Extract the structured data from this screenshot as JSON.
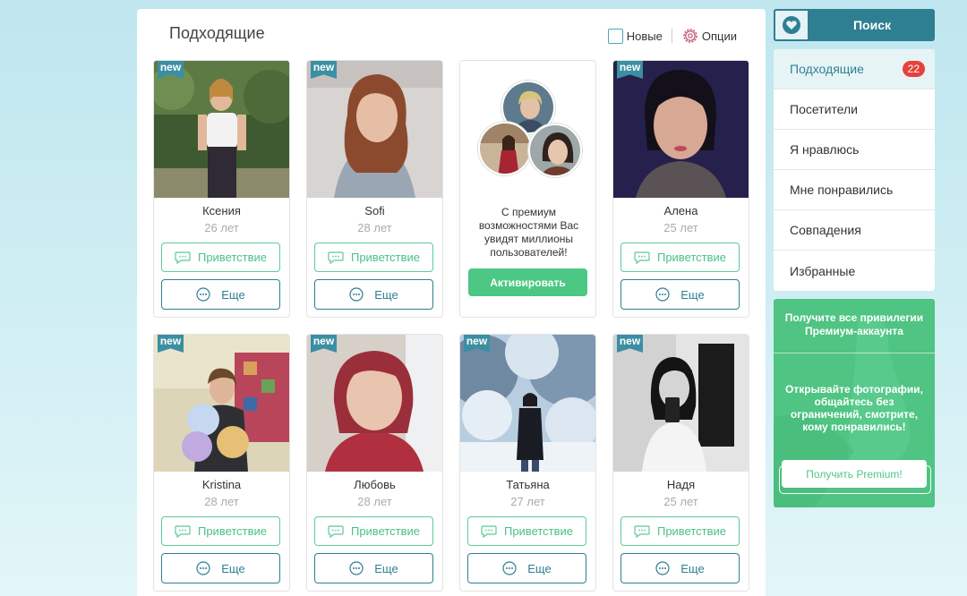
{
  "main": {
    "title": "Подходящие",
    "filter_new": "Новые",
    "options": "Опции"
  },
  "profiles": [
    {
      "name": "Ксения",
      "age": "26 лет",
      "badge": "new",
      "greet": "Приветствие",
      "more": "Еще"
    },
    {
      "name": "Sofi",
      "age": "28 лет",
      "badge": "new",
      "greet": "Приветствие",
      "more": "Еще"
    },
    {
      "name": "Алена",
      "age": "25 лет",
      "badge": "new",
      "greet": "Приветствие",
      "more": "Еще"
    },
    {
      "name": "Kristina",
      "age": "28 лет",
      "badge": "new",
      "greet": "Приветствие",
      "more": "Еще"
    },
    {
      "name": "Любовь",
      "age": "28 лет",
      "badge": "new",
      "greet": "Приветствие",
      "more": "Еще"
    },
    {
      "name": "Татьяна",
      "age": "27 лет",
      "badge": "new",
      "greet": "Приветствие",
      "more": "Еще"
    },
    {
      "name": "Надя",
      "age": "25 лет",
      "badge": "new",
      "greet": "Приветствие",
      "more": "Еще"
    }
  ],
  "promo": {
    "text": "С премиум возможностями Вас увидят миллионы пользователей!",
    "button": "Активировать"
  },
  "sidebar": {
    "search": "Поиск",
    "menu": [
      {
        "label": "Подходящие",
        "count": "22"
      },
      {
        "label": "Посетители"
      },
      {
        "label": "Я нравлюсь"
      },
      {
        "label": "Мне понравились"
      },
      {
        "label": "Совпадения"
      },
      {
        "label": "Избранные"
      }
    ],
    "premium": {
      "title": "Получите все привилегии Премиум-аккаунта",
      "desc": "Открывайте фотографии, общайтесь без ограничений, смотрите, кому понравились!",
      "button": "Получить Premium!"
    }
  },
  "colors": {
    "accent": "#2f7f93",
    "green": "#4cc784",
    "badge_red": "#e8413b"
  }
}
